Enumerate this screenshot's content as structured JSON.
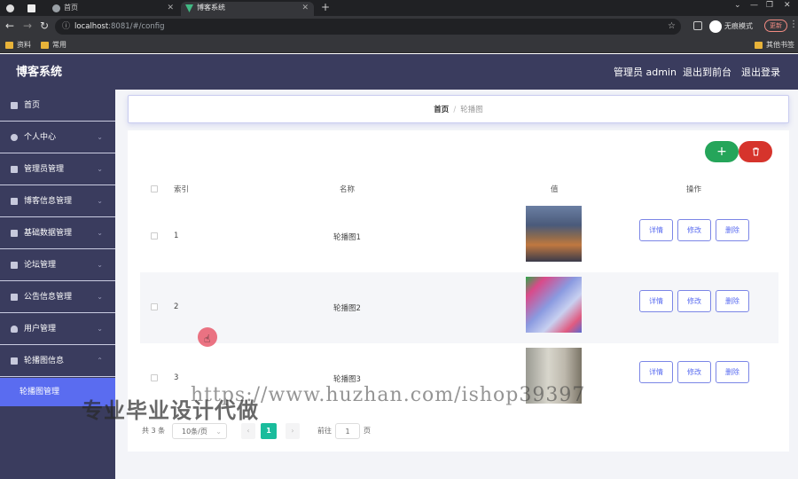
{
  "browser": {
    "tabs": [
      {
        "label": "首页"
      },
      {
        "label": "博客系统"
      }
    ],
    "new_tab_icon": "plus-icon",
    "url_host": "localhost",
    "url_rest": ":8081/#/config",
    "incognito_label": "无痕模式",
    "update_label": "更新",
    "bookmarks": [
      {
        "label": "资料"
      },
      {
        "label": "常用"
      }
    ],
    "other_bookmarks": "其他书签"
  },
  "app": {
    "brand": "博客系统",
    "header_links": {
      "admin": "管理员 admin",
      "front": "退出到前台",
      "logout": "退出登录"
    }
  },
  "sidebar": {
    "items": [
      {
        "label": "首页",
        "icon": "home-icon"
      },
      {
        "label": "个人中心",
        "icon": "user-icon"
      },
      {
        "label": "管理员管理",
        "icon": "sliders-icon"
      },
      {
        "label": "博客信息管理",
        "icon": "clipboard-icon"
      },
      {
        "label": "基础数据管理",
        "icon": "grid-icon"
      },
      {
        "label": "论坛管理",
        "icon": "chat-icon"
      },
      {
        "label": "公告信息管理",
        "icon": "list-icon"
      },
      {
        "label": "用户管理",
        "icon": "shield-icon"
      },
      {
        "label": "轮播图信息",
        "icon": "mail-icon"
      }
    ],
    "sub_item": "轮播图管理"
  },
  "breadcrumb": {
    "home": "首页",
    "separator": "/",
    "current": "轮播图"
  },
  "toolbar": {
    "add_icon": "plus-icon",
    "delete_icon": "trash-icon"
  },
  "table": {
    "columns": [
      "索引",
      "名称",
      "值",
      "操作"
    ],
    "rows": [
      {
        "index": "1",
        "name": "轮播图1"
      },
      {
        "index": "2",
        "name": "轮播图2"
      },
      {
        "index": "3",
        "name": "轮播图3"
      }
    ],
    "actions": {
      "detail": "详情",
      "edit": "修改",
      "delete": "删除"
    }
  },
  "pagination": {
    "total": "共 3 条",
    "page_size": "10条/页",
    "current_page": "1",
    "goto_prefix": "前往",
    "goto_value": "1",
    "goto_suffix": "页"
  },
  "watermark": {
    "url": "https://www.huzhan.com/ishop39397",
    "text": "专业毕业设计代做"
  },
  "colors": {
    "header_bg": "#3a3c5e",
    "accent": "#5a6cf0",
    "add_btn": "#25a55a",
    "del_btn": "#d6342c",
    "page_active": "#1abc9c"
  }
}
